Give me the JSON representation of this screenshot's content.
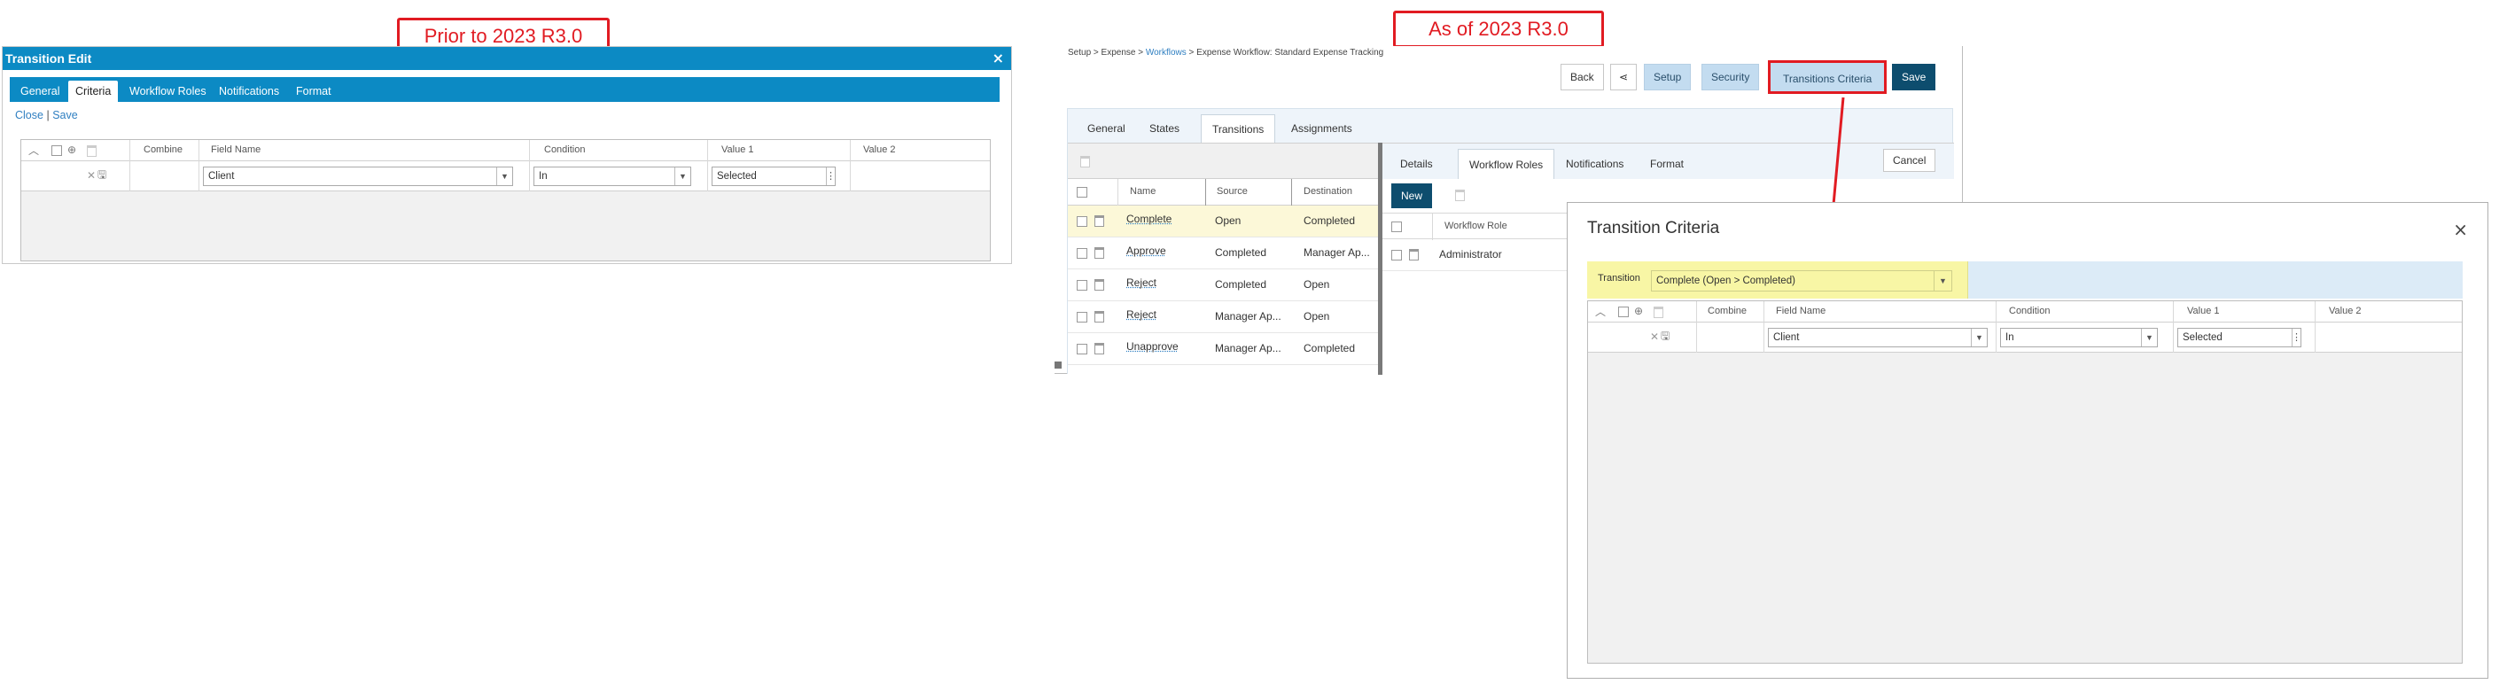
{
  "callouts": {
    "prior": "Prior to 2023 R3.0",
    "asof": "As of 2023 R3.0"
  },
  "old_dialog": {
    "title": "Transition Edit",
    "close_glyph": "×",
    "tabs": [
      {
        "label": "General"
      },
      {
        "label": "Criteria"
      },
      {
        "label": "Workflow Roles"
      },
      {
        "label": "Notifications"
      },
      {
        "label": "Format"
      }
    ],
    "actions": {
      "close": "Close",
      "separator": "|",
      "save": "Save"
    },
    "grid": {
      "headers": [
        "Combine",
        "Field Name",
        "Condition",
        "Value 1",
        "Value 2"
      ],
      "row": {
        "field_name": "Client",
        "condition": "In",
        "value1": "Selected"
      }
    }
  },
  "new_page": {
    "breadcrumb": {
      "part1": "Setup > Expense > ",
      "link": "Workflows",
      "part2": " > Expense Workflow: Standard Expense Tracking"
    },
    "toolbar": {
      "back": "Back",
      "setup": "Setup",
      "security": "Security",
      "transitions_criteria": "Transitions Criteria",
      "save": "Save"
    },
    "tabs": [
      "General",
      "States",
      "Transitions",
      "Assignments"
    ],
    "transitions_table": {
      "headers": [
        "Name",
        "Source",
        "Destination"
      ],
      "rows": [
        {
          "name": "Complete",
          "source": "Open",
          "destination": "Completed"
        },
        {
          "name": "Approve",
          "source": "Completed",
          "destination": "Manager Ap..."
        },
        {
          "name": "Reject",
          "source": "Completed",
          "destination": "Open"
        },
        {
          "name": "Reject",
          "source": "Manager Ap...",
          "destination": "Open"
        },
        {
          "name": "Unapprove",
          "source": "Manager Ap...",
          "destination": "Completed"
        }
      ]
    },
    "detail_tabs": [
      "Details",
      "Workflow Roles",
      "Notifications",
      "Format"
    ],
    "cancel": "Cancel",
    "new": "New",
    "roles": {
      "header": "Workflow Role",
      "rows": [
        "Administrator"
      ]
    }
  },
  "popup": {
    "title": "Transition Criteria",
    "close_glyph": "×",
    "transition_label": "Transition",
    "transition_value": "Complete (Open > Completed)",
    "grid": {
      "headers": [
        "Combine",
        "Field Name",
        "Condition",
        "Value 1",
        "Value 2"
      ],
      "row": {
        "field_name": "Client",
        "condition": "In",
        "value1": "Selected"
      }
    }
  },
  "colors": {
    "accent_red": "#e11b22",
    "tab_blue": "#0c8ac4",
    "button_dark": "#0d4d6e",
    "button_light": "#c3dcf0",
    "highlight_yellow": "#f8f6a5"
  },
  "icons": {
    "collapse": "chevron-up-icon",
    "add": "plus-circle-icon",
    "delete": "trash-icon",
    "share": "share-icon",
    "remove": "close-icon",
    "save_disk": "floppy-disk-icon",
    "dropdown": "caret-down-icon",
    "more": "more-vertical-icon"
  }
}
